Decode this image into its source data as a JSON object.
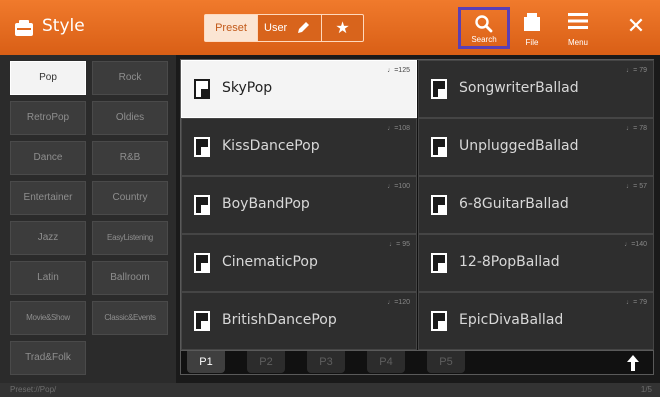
{
  "header": {
    "title": "Style",
    "title_icon": "style-icon",
    "tabs": {
      "preset": "Preset",
      "user": "User",
      "favorite": "★"
    },
    "buttons": {
      "search": "Search",
      "file": "File",
      "menu": "Menu",
      "close": "✕"
    }
  },
  "categories": [
    "Pop",
    "Rock",
    "RetroPop",
    "Oldies",
    "Dance",
    "R&B",
    "Entertainer",
    "Country",
    "Jazz",
    "EasyListening",
    "Latin",
    "Ballroom",
    "Movie&Show",
    "Classic&Events",
    "Trad&Folk"
  ],
  "selected_category": "Pop",
  "styles": [
    {
      "name": "SkyPop",
      "tempo": "♩=125",
      "selected": true
    },
    {
      "name": "SongwriterBallad",
      "tempo": "♩= 79"
    },
    {
      "name": "KissDancePop",
      "tempo": "♩=108"
    },
    {
      "name": "UnpluggedBallad",
      "tempo": "♩= 78"
    },
    {
      "name": "BoyBandPop",
      "tempo": "♩=100"
    },
    {
      "name": "6-8GuitarBallad",
      "tempo": "♩= 57"
    },
    {
      "name": "CinematicPop",
      "tempo": "♩= 95"
    },
    {
      "name": "12-8PopBallad",
      "tempo": "♩=140"
    },
    {
      "name": "BritishDancePop",
      "tempo": "♩=120"
    },
    {
      "name": "EpicDivaBallad",
      "tempo": "♩= 79"
    }
  ],
  "pages": [
    "P1",
    "P2",
    "P3",
    "P4",
    "P5"
  ],
  "active_page": "P1",
  "status": {
    "path": "Preset://Pop/",
    "page_count": "1/5"
  },
  "colors": {
    "accent": "#e36a20",
    "search_highlight": "#5b3fb3"
  }
}
